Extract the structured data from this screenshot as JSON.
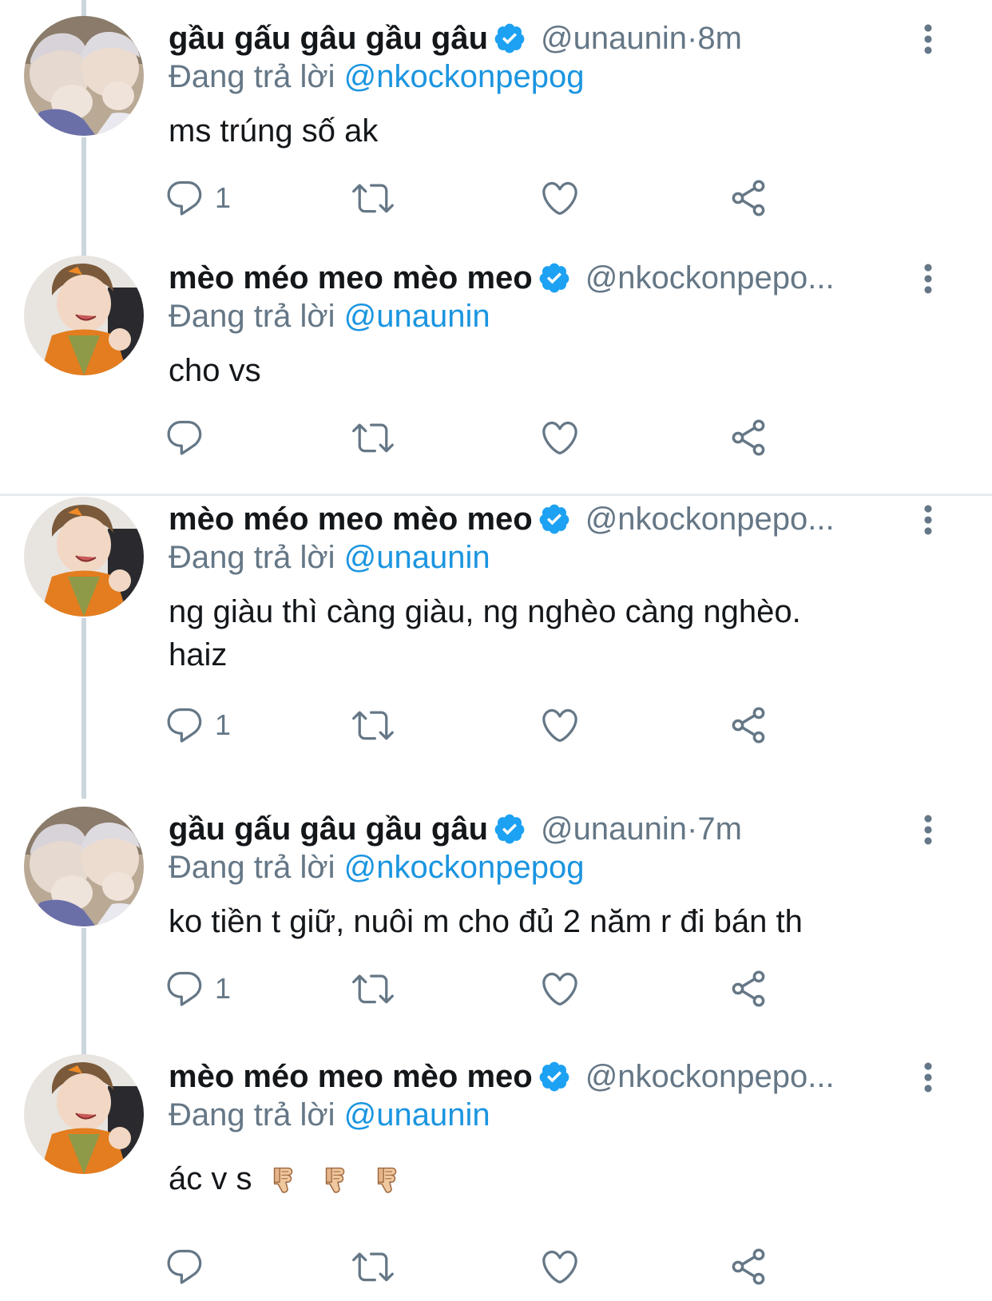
{
  "tweets": [
    {
      "name": "gầu gấu gâu gầu gâu",
      "handle": "@unaunin",
      "time_sep": " · ",
      "time": "8m",
      "reply_prefix": "Đang trả lời ",
      "reply_to": "@nkockonpepog",
      "text": "ms trúng số ak",
      "reply_count": "1"
    },
    {
      "name": "mèo méo meo mèo meo",
      "handle": "@nkockonpepo...",
      "time_sep": "",
      "time": "",
      "reply_prefix": "Đang trả lời ",
      "reply_to": "@unaunin",
      "text": "cho vs",
      "reply_count": ""
    },
    {
      "name": "mèo méo meo mèo meo",
      "handle": "@nkockonpepo...",
      "time_sep": "",
      "time": "",
      "reply_prefix": "Đang trả lời ",
      "reply_to": "@unaunin",
      "text": "ng giàu thì càng giàu, ng nghèo càng nghèo.",
      "text2": "haiz",
      "reply_count": "1"
    },
    {
      "name": "gầu gấu gâu gầu gâu",
      "handle": "@unaunin",
      "time_sep": " · ",
      "time": "7m",
      "reply_prefix": "Đang trả lời ",
      "reply_to": "@nkockonpepog",
      "text": "ko tiền t giữ, nuôi m cho đủ 2 năm r đi bán th",
      "reply_count": "1"
    },
    {
      "name": "mèo méo meo mèo meo",
      "handle": "@nkockonpepo...",
      "time_sep": "",
      "time": "",
      "reply_prefix": "Đang trả lời ",
      "reply_to": "@unaunin",
      "text": "ác v s",
      "reply_count": ""
    }
  ],
  "icons": {
    "reply": "reply-icon",
    "retweet": "retweet-icon",
    "like": "heart-icon",
    "share": "share-icon",
    "more": "more-vertical-icon",
    "verified": "verified-badge-icon",
    "emoji": "thumbs-down-emoji"
  },
  "colors": {
    "accent": "#1da1f2",
    "mention": "#1b95e0",
    "secondary_text": "#657786",
    "icon_gray": "#657786",
    "thread_line": "#ccd6dd",
    "divider": "#e6ecf0"
  }
}
